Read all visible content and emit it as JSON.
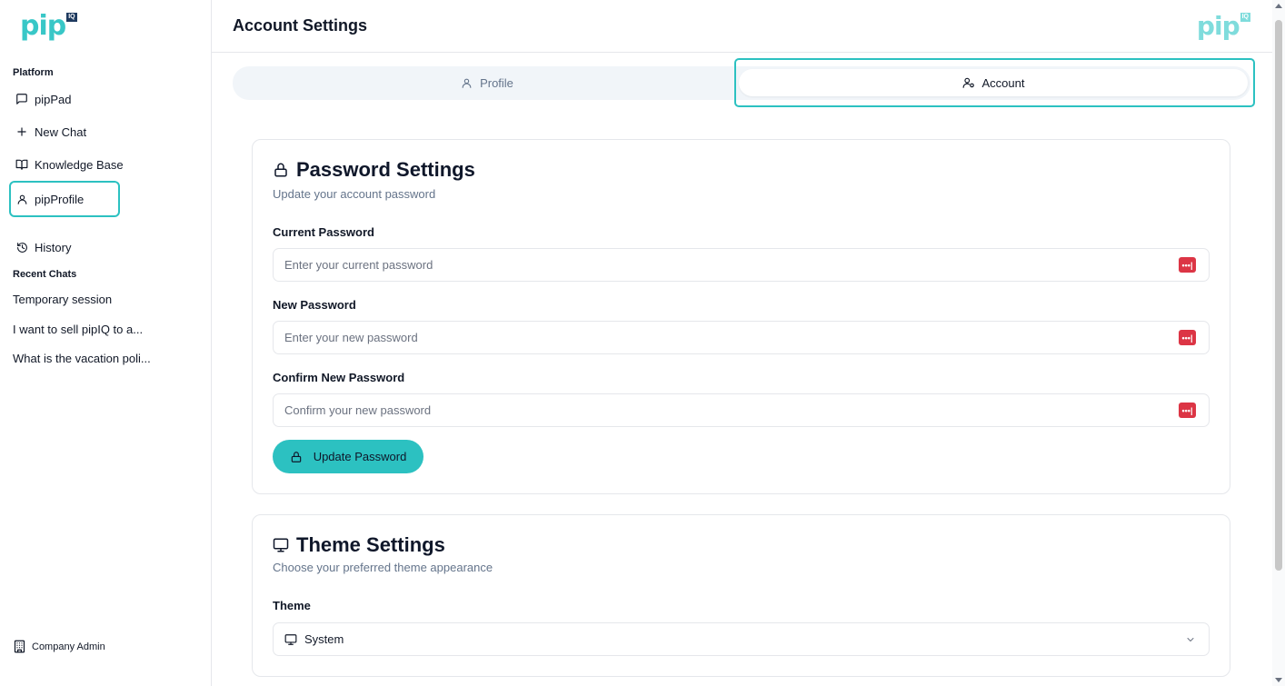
{
  "sidebar": {
    "logo": {
      "text": "pip",
      "badge": "IQ"
    },
    "platform_label": "Platform",
    "items": [
      {
        "label": "pipPad",
        "icon": "message-square-icon"
      },
      {
        "label": "New Chat",
        "icon": "plus-icon"
      },
      {
        "label": "Knowledge Base",
        "icon": "book-open-icon"
      },
      {
        "label": "pipProfile",
        "icon": "user-icon",
        "active": true
      },
      {
        "label": "History",
        "icon": "history-icon"
      }
    ],
    "recent_label": "Recent Chats",
    "recent_chats": [
      "Temporary session",
      "I want to sell pipIQ to a...",
      "What is the vacation poli..."
    ],
    "admin_label": "Company Admin"
  },
  "header": {
    "title": "Account Settings",
    "logo": {
      "text": "pip",
      "badge": "IQ"
    }
  },
  "tabs": [
    {
      "label": "Profile",
      "icon": "user-icon"
    },
    {
      "label": "Account",
      "icon": "user-cog-icon",
      "selected": true
    }
  ],
  "password_card": {
    "title": "Password Settings",
    "subtitle": "Update your account password",
    "fields": [
      {
        "label": "Current Password",
        "placeholder": "Enter your current password"
      },
      {
        "label": "New Password",
        "placeholder": "Enter your new password"
      },
      {
        "label": "Confirm New Password",
        "placeholder": "Confirm your new password"
      }
    ],
    "pw_manager_glyph": "•••|",
    "button_label": "Update Password"
  },
  "theme_card": {
    "title": "Theme Settings",
    "subtitle": "Choose your preferred theme appearance",
    "field_label": "Theme",
    "selected_value": "System"
  },
  "colors": {
    "accent": "#2cc1c1",
    "pw_icon": "#dc3545",
    "muted_text": "#64748b"
  }
}
